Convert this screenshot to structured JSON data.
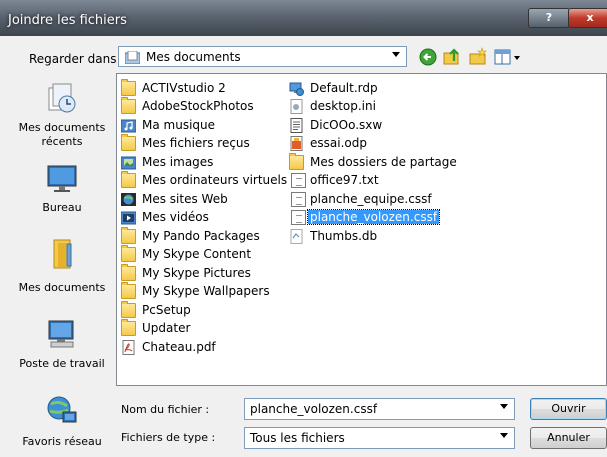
{
  "window": {
    "title": "Joindre les fichiers",
    "help_label": "?",
    "close_label": "x"
  },
  "lookin": {
    "label": "Regarder dans :",
    "value": "Mes documents"
  },
  "toolbar": {
    "back_icon": "back-green-icon",
    "up_icon": "up-folder-icon",
    "new_folder_icon": "new-folder-icon",
    "views_icon": "views-menu-icon"
  },
  "places": [
    {
      "label": "Mes documents récents",
      "icon": "recent-documents-icon"
    },
    {
      "label": "Bureau",
      "icon": "desktop-icon"
    },
    {
      "label": "Mes documents",
      "icon": "my-documents-icon"
    },
    {
      "label": "Poste de travail",
      "icon": "computer-icon"
    },
    {
      "label": "Favoris réseau",
      "icon": "network-icon"
    }
  ],
  "files_col1": [
    {
      "name": "ACTIVstudio 2",
      "type": "folder"
    },
    {
      "name": "AdobeStockPhotos",
      "type": "folder"
    },
    {
      "name": "Ma musique",
      "type": "music"
    },
    {
      "name": "Mes fichiers reçus",
      "type": "folder"
    },
    {
      "name": "Mes images",
      "type": "pictures"
    },
    {
      "name": "Mes ordinateurs virtuels",
      "type": "folder"
    },
    {
      "name": "Mes sites Web",
      "type": "web"
    },
    {
      "name": "Mes vidéos",
      "type": "video"
    },
    {
      "name": "My Pando Packages",
      "type": "folder"
    },
    {
      "name": "My Skype Content",
      "type": "folder"
    },
    {
      "name": "My Skype Pictures",
      "type": "folder"
    },
    {
      "name": "My Skype Wallpapers",
      "type": "folder"
    },
    {
      "name": "PcSetup",
      "type": "folder"
    },
    {
      "name": "Updater",
      "type": "folder"
    },
    {
      "name": "Chateau.pdf",
      "type": "pdf"
    }
  ],
  "files_col2": [
    {
      "name": "Default.rdp",
      "type": "rdp"
    },
    {
      "name": "desktop.ini",
      "type": "ini"
    },
    {
      "name": "DicOOo.sxw",
      "type": "sxw"
    },
    {
      "name": "essai.odp",
      "type": "odp"
    },
    {
      "name": "Mes dossiers de partage",
      "type": "folder"
    },
    {
      "name": "office97.txt",
      "type": "txt"
    },
    {
      "name": "planche_equipe.cssf",
      "type": "file"
    },
    {
      "name": "planche_volozen.cssf",
      "type": "file",
      "selected": true
    },
    {
      "name": "Thumbs.db",
      "type": "db"
    }
  ],
  "filename": {
    "label": "Nom du fichier :",
    "value": "planche_volozen.cssf"
  },
  "filetype": {
    "label": "Fichiers de type :",
    "value": "Tous les fichiers"
  },
  "buttons": {
    "open": "Ouvrir",
    "cancel": "Annuler"
  },
  "colors": {
    "selection": "#3399ff",
    "title_bar": "#4a525c",
    "folder": "#f3c948"
  }
}
